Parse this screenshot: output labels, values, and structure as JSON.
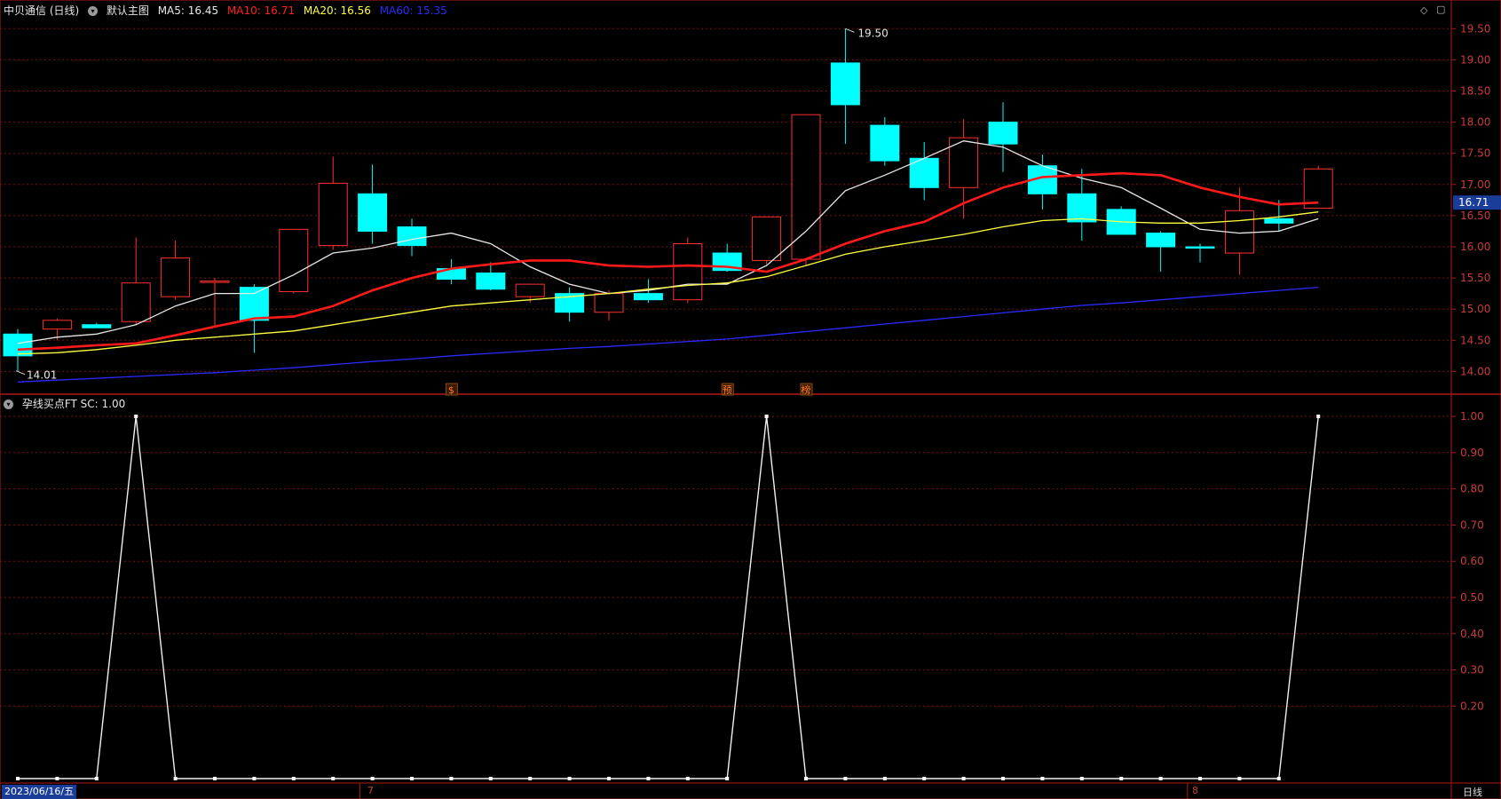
{
  "header": {
    "title": "中贝通信 (日线)",
    "main_chart_label": "默认主图",
    "ma5_label": "MA5: 16.45",
    "ma10_label": "MA10: 16.71",
    "ma20_label": "MA20: 16.56",
    "ma60_label": "MA60: 15.35"
  },
  "colors": {
    "up": "#ff3030",
    "down": "#00ffff",
    "ma5": "#e8e8e8",
    "ma10": "#ff1a1a",
    "ma20": "#ffff40",
    "ma60": "#2a2aff",
    "grid": "#7a1010",
    "axis_text": "#c83c3c",
    "last_price_box": "#1a3d9a"
  },
  "indicator": {
    "label": "孕线买点FT SC: 1.00"
  },
  "markers": [
    {
      "text": "$",
      "index": 11
    },
    {
      "text": "预",
      "index": 18
    },
    {
      "text": "榜",
      "index": 20
    }
  ],
  "bottom": {
    "date_label": "2023/06/16/五",
    "month_labels": [
      {
        "text": "7",
        "index": 9
      },
      {
        "text": "8",
        "index": 30
      }
    ],
    "period_button": "日线"
  },
  "chart_data": [
    {
      "type": "candlestick",
      "y_axis_ticks": [
        "19.50",
        "19.00",
        "18.50",
        "18.00",
        "17.50",
        "17.00",
        "16.50",
        "16.00",
        "15.50",
        "15.00",
        "14.50",
        "14.00"
      ],
      "ylim": [
        13.6,
        19.7
      ],
      "last_price": "16.71",
      "high_annotation": "19.50",
      "low_annotation": "14.01",
      "ohlc": [
        [
          14.6,
          14.68,
          14.01,
          14.25
        ],
        [
          14.68,
          14.85,
          14.5,
          14.82
        ],
        [
          14.75,
          14.78,
          14.7,
          14.7
        ],
        [
          14.8,
          16.15,
          14.75,
          15.42
        ],
        [
          15.2,
          16.1,
          15.15,
          15.82
        ],
        [
          15.45,
          15.5,
          14.7,
          15.45
        ],
        [
          15.35,
          15.4,
          14.3,
          14.82
        ],
        [
          15.28,
          16.28,
          15.25,
          16.28
        ],
        [
          16.02,
          17.45,
          15.95,
          17.02
        ],
        [
          16.85,
          17.32,
          16.05,
          16.25
        ],
        [
          16.32,
          16.45,
          15.85,
          16.02
        ],
        [
          15.65,
          15.8,
          15.4,
          15.48
        ],
        [
          15.58,
          15.75,
          15.3,
          15.32
        ],
        [
          15.2,
          15.4,
          15.1,
          15.4
        ],
        [
          15.25,
          15.35,
          14.8,
          14.95
        ],
        [
          14.95,
          15.3,
          14.82,
          15.25
        ],
        [
          15.25,
          15.48,
          15.1,
          15.15
        ],
        [
          15.15,
          16.15,
          15.1,
          16.05
        ],
        [
          15.9,
          16.05,
          15.6,
          15.62
        ],
        [
          15.78,
          16.48,
          15.72,
          16.48
        ],
        [
          15.8,
          17.1,
          15.7,
          18.12
        ],
        [
          18.95,
          19.5,
          17.65,
          18.28
        ],
        [
          17.95,
          18.08,
          17.3,
          17.38
        ],
        [
          17.42,
          17.68,
          16.75,
          16.95
        ],
        [
          16.95,
          18.05,
          16.45,
          17.75
        ],
        [
          18.0,
          18.32,
          17.2,
          17.65
        ],
        [
          17.3,
          17.48,
          16.6,
          16.85
        ],
        [
          16.85,
          17.25,
          16.1,
          16.4
        ],
        [
          16.6,
          16.65,
          16.2,
          16.2
        ],
        [
          16.22,
          16.25,
          15.6,
          16.0
        ],
        [
          16.0,
          16.05,
          15.75,
          15.98
        ],
        [
          15.9,
          16.95,
          15.55,
          16.58
        ],
        [
          16.45,
          16.75,
          16.25,
          16.38
        ],
        [
          16.62,
          17.3,
          16.62,
          17.25
        ]
      ],
      "series": [
        {
          "name": "MA5",
          "values": [
            14.45,
            14.55,
            14.6,
            14.75,
            15.05,
            15.25,
            15.25,
            15.55,
            15.9,
            15.98,
            16.12,
            16.22,
            16.05,
            15.68,
            15.4,
            15.25,
            15.3,
            15.4,
            15.4,
            15.7,
            16.25,
            16.9,
            17.15,
            17.42,
            17.7,
            17.6,
            17.3,
            17.1,
            16.95,
            16.62,
            16.28,
            16.22,
            16.25,
            16.45
          ]
        },
        {
          "name": "MA10",
          "values": [
            14.35,
            14.38,
            14.42,
            14.45,
            14.58,
            14.72,
            14.85,
            14.88,
            15.05,
            15.3,
            15.5,
            15.65,
            15.72,
            15.78,
            15.78,
            15.7,
            15.68,
            15.7,
            15.68,
            15.6,
            15.8,
            16.05,
            16.25,
            16.4,
            16.7,
            16.95,
            17.12,
            17.15,
            17.18,
            17.15,
            16.95,
            16.8,
            16.68,
            16.71
          ]
        },
        {
          "name": "MA20",
          "values": [
            14.28,
            14.3,
            14.35,
            14.42,
            14.5,
            14.55,
            14.6,
            14.65,
            14.75,
            14.85,
            14.95,
            15.05,
            15.1,
            15.15,
            15.2,
            15.25,
            15.32,
            15.38,
            15.42,
            15.52,
            15.7,
            15.88,
            16.0,
            16.1,
            16.2,
            16.32,
            16.42,
            16.45,
            16.4,
            16.38,
            16.38,
            16.42,
            16.48,
            16.56
          ]
        },
        {
          "name": "MA60",
          "values": [
            13.83,
            13.86,
            13.89,
            13.92,
            13.95,
            13.98,
            14.02,
            14.06,
            14.11,
            14.16,
            14.2,
            14.25,
            14.29,
            14.33,
            14.37,
            14.4,
            14.44,
            14.48,
            14.52,
            14.58,
            14.64,
            14.7,
            14.76,
            14.82,
            14.88,
            14.94,
            15.0,
            15.06,
            15.1,
            15.15,
            15.2,
            15.25,
            15.3,
            15.35
          ]
        }
      ]
    },
    {
      "type": "line",
      "name": "孕线买点FT",
      "y_axis_ticks": [
        "1.00",
        "0.90",
        "0.80",
        "0.70",
        "0.60",
        "0.50",
        "0.40",
        "0.30",
        "0.20"
      ],
      "ylim": [
        0,
        1.05
      ],
      "values": [
        0,
        0,
        0,
        1,
        0,
        0,
        0,
        0,
        0,
        0,
        0,
        0,
        0,
        0,
        0,
        0,
        0,
        0,
        0,
        1,
        0,
        0,
        0,
        0,
        0,
        0,
        0,
        0,
        0,
        0,
        0,
        0,
        0,
        1
      ]
    }
  ]
}
